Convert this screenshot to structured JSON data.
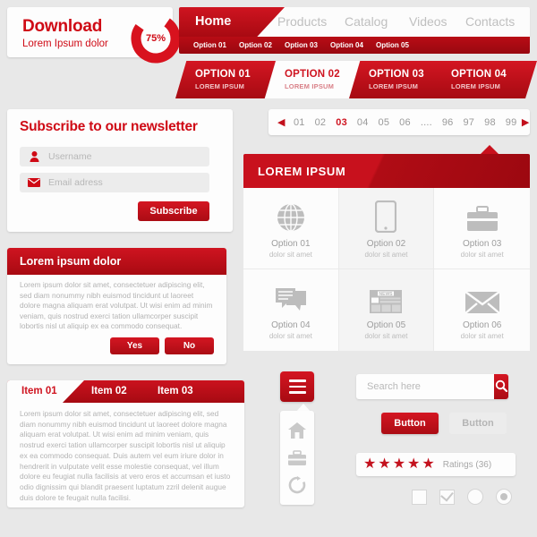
{
  "download": {
    "title": "Download",
    "subtitle": "Lorem Ipsum dolor",
    "gauge_percent": "75%",
    "gauge_value": 75,
    "accent": "#cf0a15"
  },
  "topnav": {
    "items": [
      {
        "label": "Home",
        "active": true
      },
      {
        "label": "Products",
        "active": false
      },
      {
        "label": "Catalog",
        "active": false
      },
      {
        "label": "Videos",
        "active": false
      },
      {
        "label": "Contacts",
        "active": false
      }
    ],
    "subitems": [
      {
        "label": "Option 01"
      },
      {
        "label": "Option 02"
      },
      {
        "label": "Option 03"
      },
      {
        "label": "Option 04"
      },
      {
        "label": "Option 05"
      }
    ]
  },
  "ribbon": {
    "segments": [
      {
        "title": "OPTION 01",
        "subtitle": "LOREM IPSUM",
        "style": "red"
      },
      {
        "title": "OPTION 02",
        "subtitle": "LOREM IPSUM",
        "style": "white"
      },
      {
        "title": "OPTION 03",
        "subtitle": "LOREM IPSUM",
        "style": "red"
      },
      {
        "title": "OPTION 04",
        "subtitle": "LOREM IPSUM",
        "style": "red"
      }
    ]
  },
  "pagination": {
    "prev_icon": "triangle-left-icon",
    "next_icon": "triangle-right-icon",
    "pages": [
      "01",
      "02",
      "03",
      "04",
      "05",
      "06",
      "....",
      "96",
      "97",
      "98",
      "99"
    ],
    "current": "03"
  },
  "newsletter": {
    "title": "Subscribe to our newsletter",
    "username_placeholder": "Username",
    "email_placeholder": "Email adress",
    "username_icon": "user-icon",
    "email_icon": "envelope-icon",
    "submit_label": "Subscribe"
  },
  "dialog": {
    "title": "Lorem ipsum dolor",
    "body": "Lorem ipsum dolor sit amet, consectetuer adipiscing elit, sed diam nonummy nibh euismod tincidunt ut laoreet dolore magna aliquam erat volutpat. Ut wisi enim ad minim veniam, quis nostrud exerci tation ullamcorper suscipit lobortis nisl ut aliquip ex ea commodo consequat.",
    "yes_label": "Yes",
    "no_label": "No"
  },
  "tabs": {
    "items": [
      {
        "label": "Item 01",
        "active": true
      },
      {
        "label": "Item 02",
        "active": false
      },
      {
        "label": "Item 03",
        "active": false
      }
    ],
    "body": "Lorem ipsum dolor sit amet, consectetuer adipiscing elit, sed diam nonummy nibh euismod tincidunt ut laoreet dolore magna aliquam erat volutpat. Ut wisi enim ad minim veniam, quis nostrud exerci tation ullamcorper suscipit lobortis nisl ut aliquip ex ea commodo consequat. Duis autem vel eum iriure dolor in hendrerit in vulputate velit esse molestie consequat, vel illum dolore eu feugiat nulla facilisis at vero eros et accumsan et iusto odio dignissim qui blandit praesent luptatum zzril delenit augue duis dolore te feugait nulla facilisi."
  },
  "grid_panel": {
    "title": "LOREM IPSUM",
    "cells": [
      {
        "title": "Option 01",
        "subtitle": "dolor sit amet",
        "icon": "globe-icon",
        "alt": false
      },
      {
        "title": "Option 02",
        "subtitle": "dolor sit amet",
        "icon": "smartphone-icon",
        "alt": true
      },
      {
        "title": "Option 03",
        "subtitle": "dolor sit amet",
        "icon": "briefcase-icon",
        "alt": false
      },
      {
        "title": "Option 04",
        "subtitle": "dolor sit amet",
        "icon": "chat-bubbles-icon",
        "alt": false
      },
      {
        "title": "Option 05",
        "subtitle": "dolor sit amet",
        "icon": "newspaper-icon",
        "alt": true
      },
      {
        "title": "Option 06",
        "subtitle": "dolor sit amet",
        "icon": "envelope-icon",
        "alt": false
      }
    ]
  },
  "icon_column": {
    "menu_icon": "hamburger-menu-icon",
    "items": [
      {
        "icon": "home-icon"
      },
      {
        "icon": "briefcase-icon"
      },
      {
        "icon": "refresh-icon"
      }
    ]
  },
  "search": {
    "placeholder": "Search here",
    "value": "",
    "button_icon": "search-icon"
  },
  "buttons": {
    "primary_label": "Button",
    "secondary_label": "Button"
  },
  "ratings": {
    "stars": 5,
    "star_glyph": "★",
    "label": "Ratings (36)"
  },
  "toggles": {
    "checkbox_unchecked": "checkbox-unchecked",
    "checkbox_checked": "checkbox-checked",
    "radio_unselected": "radio-unselected",
    "radio_selected": "radio-selected"
  },
  "colors": {
    "accent_red": "#cf1420",
    "dark_red": "#a80a12",
    "page_bg": "#e8e8e8",
    "panel_bg": "#fdfdfd",
    "muted_text": "#b3b3b3"
  }
}
